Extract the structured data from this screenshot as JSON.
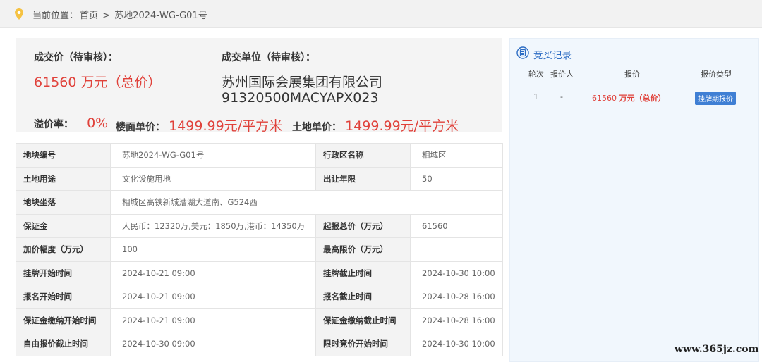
{
  "breadcrumb": {
    "prefix": "当前位置：",
    "home": "首页",
    "sep": ">",
    "current": "苏地2024-WG-G01号"
  },
  "summary": {
    "deal_price_label": "成交价（待审核）：",
    "deal_price_value": "61560 万元（总价）",
    "buyer_label": "成交单位（待审核）：",
    "buyer_name": "苏州国际会展集团有限公司",
    "buyer_code": "91320500MACYAPX023",
    "premium_label": "溢价率：",
    "premium_value": "0%",
    "floor_price_label": "楼面单价：",
    "floor_price_value": "1499.99元/平方米",
    "land_price_label": "土地单价：",
    "land_price_value": "1499.99元/平方米"
  },
  "details": [
    {
      "k1": "地块编号",
      "v1": "苏地2024-WG-G01号",
      "k2": "行政区名称",
      "v2": "相城区"
    },
    {
      "k1": "土地用途",
      "v1": "文化设施用地",
      "k2": "出让年限",
      "v2": "50"
    },
    {
      "k1": "地块坐落",
      "v1": "相城区高铁新城漕湖大道南、G524西"
    },
    {
      "k1": "保证金",
      "v1": "人民币：12320万,美元：1850万,港币：14350万",
      "k2": "起报总价（万元）",
      "v2": "61560"
    },
    {
      "k1": "加价幅度（万元）",
      "v1": "100",
      "k2": "最高限价（万元）",
      "v2": ""
    },
    {
      "k1": "挂牌开始时间",
      "v1": "2024-10-21 09:00",
      "k2": "挂牌截止时间",
      "v2": "2024-10-30 10:00"
    },
    {
      "k1": "报名开始时间",
      "v1": "2024-10-21 09:00",
      "k2": "报名截止时间",
      "v2": "2024-10-28 16:00"
    },
    {
      "k1": "保证金缴纳开始时间",
      "v1": "2024-10-21 09:00",
      "k2": "保证金缴纳截止时间",
      "v2": "2024-10-28 16:00"
    },
    {
      "k1": "自由报价截止时间",
      "v1": "2024-10-30 09:00",
      "k2": "限时竞价开始时间",
      "v2": "2024-10-30 10:00"
    }
  ],
  "bids": {
    "title": "竞买记录",
    "headers": {
      "round": "轮次",
      "bidder": "报价人",
      "price": "报价",
      "type": "报价类型"
    },
    "rows": [
      {
        "round": "1",
        "bidder": "-",
        "price_num": "61560",
        "price_unit": "万元（总价）",
        "type": "挂牌期报价"
      }
    ]
  },
  "watermark": "www.365jz.com",
  "colors": {
    "accent_red": "#e0413a",
    "accent_blue": "#2d6dc4",
    "badge_blue": "#3f7fd4",
    "pin_yellow": "#f5c242"
  },
  "icons": {
    "breadcrumb": "location-pin-icon",
    "bids": "document-circle-icon"
  }
}
